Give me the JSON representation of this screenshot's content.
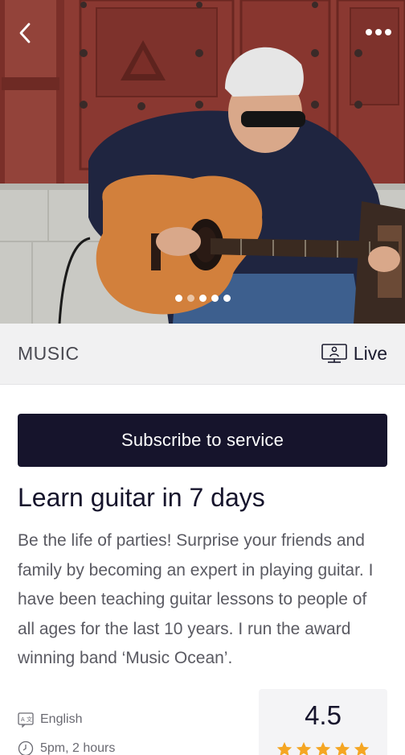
{
  "hero": {
    "image": "guitarist-photo",
    "slide_count": 5,
    "active_slide": 1
  },
  "header": {
    "back_icon": "chevron-left-icon",
    "more_icon": "more-horizontal-icon"
  },
  "category_bar": {
    "category": "MUSIC",
    "live_label": "Live",
    "live_icon": "live-stream-icon"
  },
  "subscribe_label": "Subscribe to service",
  "course": {
    "title": "Learn guitar in 7 days",
    "description": "Be the life of parties! Surprise your friends and family by becoming an expert in playing guitar. I have been teaching guitar lessons to people of all ages for the last 10 years. I run the award winning band ‘Music Ocean’."
  },
  "meta": {
    "language": "English",
    "language_icon": "translate-icon",
    "schedule": "5pm, 2 hours",
    "schedule_icon": "clock-icon"
  },
  "rating": {
    "value": "4.5",
    "stars": 5,
    "star_color": "#f5a623"
  },
  "colors": {
    "primary": "#16142c",
    "category_bg": "#f1f1f2"
  }
}
